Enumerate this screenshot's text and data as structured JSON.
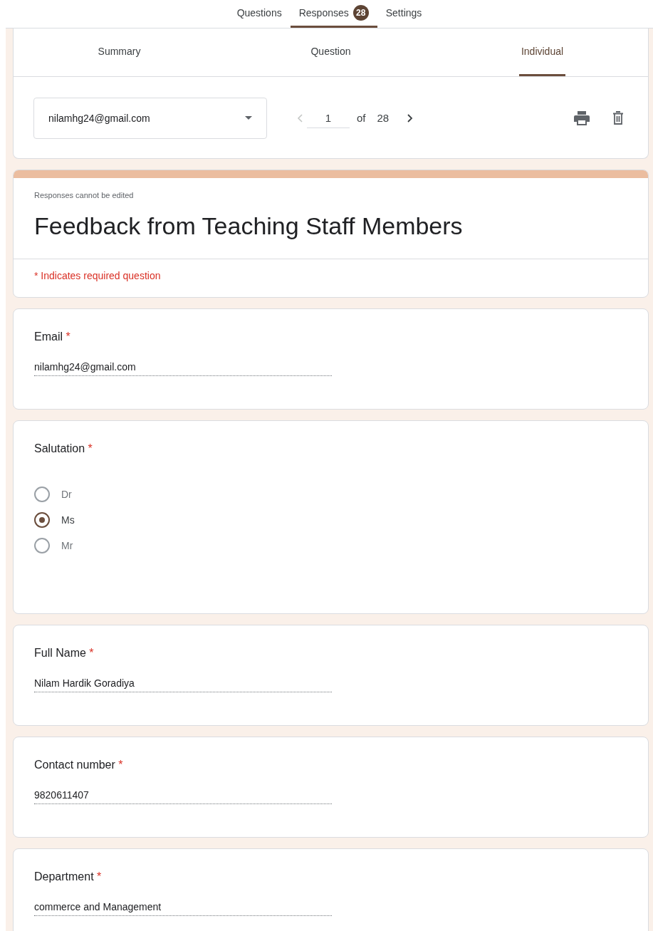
{
  "top_tabs": [
    {
      "label": "Questions",
      "selected": false
    },
    {
      "label": "Responses",
      "selected": true,
      "badge": "28"
    },
    {
      "label": "Settings",
      "selected": false
    }
  ],
  "response_tabs": [
    {
      "label": "Summary",
      "selected": false
    },
    {
      "label": "Question",
      "selected": false
    },
    {
      "label": "Individual",
      "selected": true
    }
  ],
  "respondent_select": {
    "value": "nilamhg24@gmail.com"
  },
  "pager": {
    "current": "1",
    "of_label": "of",
    "total": "28"
  },
  "form_header": {
    "notice": "Responses cannot be edited",
    "title": "Feedback from Teaching Staff Members",
    "required_note": "* Indicates required question"
  },
  "questions": [
    {
      "kind": "text",
      "title": "Email",
      "required_mark": "*",
      "answer": "nilamhg24@gmail.com"
    },
    {
      "kind": "radio",
      "title": "Salutation",
      "required_mark": "*",
      "options": [
        {
          "label": "Dr",
          "selected": false
        },
        {
          "label": "Ms",
          "selected": true
        },
        {
          "label": "Mr",
          "selected": false
        }
      ]
    },
    {
      "kind": "text",
      "title": "Full Name",
      "required_mark": "*",
      "answer": "Nilam Hardik Goradiya"
    },
    {
      "kind": "text",
      "title": "Contact number",
      "required_mark": "*",
      "answer": "9820611407"
    },
    {
      "kind": "text",
      "title": "Department ",
      "required_mark": "*",
      "answer": "commerce and Management"
    }
  ]
}
